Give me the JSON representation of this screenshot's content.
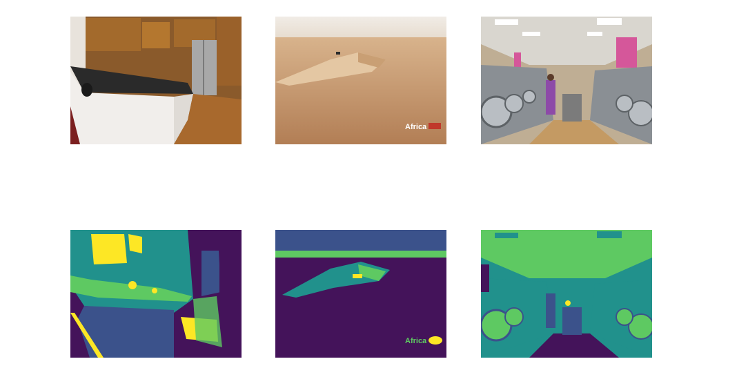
{
  "figure": {
    "rows": [
      {
        "name": "input-images",
        "tiles": [
          {
            "id": "kitchen-photo",
            "scene": "kitchen",
            "kind": "photo"
          },
          {
            "id": "desert-photo",
            "scene": "desert",
            "kind": "photo",
            "watermark": "Africa"
          },
          {
            "id": "laundromat-photo",
            "scene": "laundromat",
            "kind": "photo"
          }
        ]
      },
      {
        "name": "segmentation-maps",
        "tiles": [
          {
            "id": "kitchen-seg",
            "scene": "kitchen",
            "kind": "segmentation"
          },
          {
            "id": "desert-seg",
            "scene": "desert",
            "kind": "segmentation",
            "watermark": "Africa"
          },
          {
            "id": "laundromat-seg",
            "scene": "laundromat",
            "kind": "segmentation"
          }
        ]
      }
    ],
    "palette": {
      "purple": "#44135a",
      "indigo": "#3b528b",
      "teal": "#21918c",
      "green": "#5ec962",
      "yellow": "#fde725"
    }
  }
}
